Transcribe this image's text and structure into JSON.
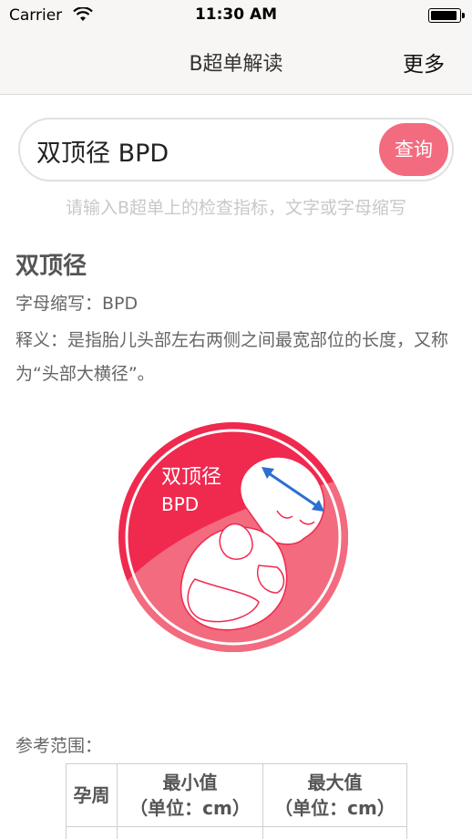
{
  "status_bar": {
    "carrier": "Carrier",
    "time": "11:30 AM"
  },
  "nav": {
    "title": "B超单解读",
    "more": "更多"
  },
  "search": {
    "value": "双顶径 BPD",
    "button_label": "查询",
    "hint": "请输入B超单上的检查指标，文字或字母缩写"
  },
  "term": {
    "name": "双顶径",
    "abbreviation": "字母缩写：BPD",
    "definition": "释义：是指胎儿头部左右两侧之间最宽部位的长度，又称为“头部大横径”。"
  },
  "illustration": {
    "label_line1": "双顶径",
    "label_line2": "BPD",
    "colors": {
      "outer": "#f0294f",
      "inner": "#f26b7e",
      "arrow": "#2b6fd1"
    }
  },
  "reference": {
    "label": "参考范围：",
    "columns": [
      "孕周",
      "最小值\n（单位：cm）",
      "最大值\n（单位：cm）"
    ],
    "col_min_line1": "最小值",
    "col_min_line2": "（单位：cm）",
    "col_max_line1": "最大值",
    "col_max_line2": "（单位：cm）"
  }
}
